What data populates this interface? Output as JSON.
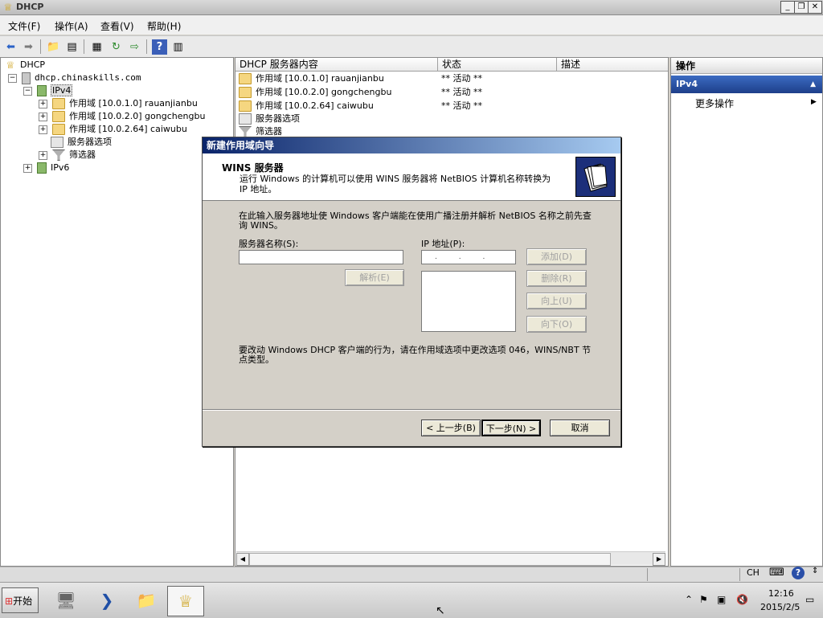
{
  "window": {
    "title": "DHCP"
  },
  "menu": [
    "文件(F)",
    "操作(A)",
    "查看(V)",
    "帮助(H)"
  ],
  "tree": {
    "root": "DHCP",
    "server": "dhcp.chinaskills.com",
    "ipv4": "IPv4",
    "scopes": [
      "作用域 [10.0.1.0] rauanjianbu",
      "作用域 [10.0.2.0] gongchengbu",
      "作用域 [10.0.2.64] caiwubu"
    ],
    "server_options": "服务器选项",
    "filters": "筛选器",
    "ipv6": "IPv6"
  },
  "content": {
    "columns": [
      "DHCP 服务器内容",
      "状态",
      "描述"
    ],
    "rows": [
      {
        "name": "作用域 [10.0.1.0] rauanjianbu",
        "status": "** 活动 **"
      },
      {
        "name": "作用域 [10.0.2.0] gongchengbu",
        "status": "** 活动 **"
      },
      {
        "name": "作用域 [10.0.2.64] caiwubu",
        "status": "** 活动 **"
      },
      {
        "name": "服务器选项",
        "status": ""
      },
      {
        "name": "筛选器",
        "status": ""
      }
    ]
  },
  "actions": {
    "header": "操作",
    "section": "IPv4",
    "more": "更多操作"
  },
  "dialog": {
    "title": "新建作用域向导",
    "header_title": "WINS 服务器",
    "header_subtitle": "运行 Windows 的计算机可以使用 WINS 服务器将 NetBIOS 计算机名称转换为 IP 地址。",
    "intro": "在此输入服务器地址使 Windows 客户端能在使用广播注册并解析 NetBIOS 名称之前先查询 WINS。",
    "server_name_label": "服务器名称(S):",
    "ip_label": "IP 地址(P):",
    "ip_placeholder": ". . .",
    "resolve_button": "解析(E)",
    "add_button": "添加(D)",
    "remove_button": "删除(R)",
    "up_button": "向上(U)",
    "down_button": "向下(O)",
    "note": "要改动 Windows DHCP 客户端的行为，请在作用域选项中更改选项 046，WINS/NBT 节点类型。",
    "back_button": "< 上一步(B)",
    "next_button": "下一步(N) >",
    "cancel_button": "取消"
  },
  "taskbar": {
    "start": "开始",
    "lang": "CH",
    "time": "12:16",
    "date": "2015/2/5"
  }
}
